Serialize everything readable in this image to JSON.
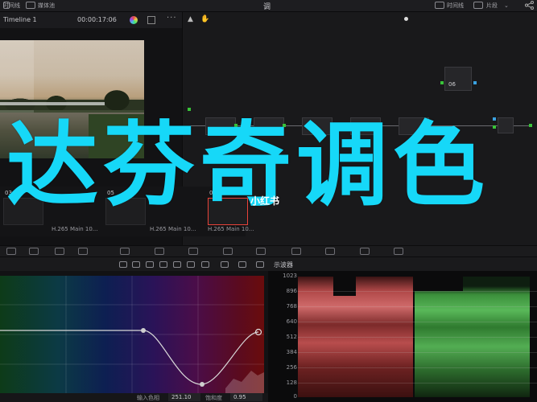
{
  "topbar": {
    "left_items": [
      "时间线",
      "媒体池"
    ],
    "center_title": "调",
    "right_items": [
      "时间线",
      "片段"
    ],
    "dropdown_arrow": "⌄"
  },
  "viewer": {
    "timeline_name": "Timeline 1",
    "timecode": "00:00:17:06",
    "more": "···"
  },
  "nodes": {
    "node_labels": [
      "06"
    ]
  },
  "overlay": {
    "title": "达芬奇调色",
    "watermark": "小红书"
  },
  "clips": {
    "numbers": [
      "03",
      "05",
      "07"
    ],
    "names": [
      "H.265 Main 10...",
      "H.265 Main 10...",
      "H.265 Main 10..."
    ]
  },
  "scopes": {
    "title": "示波器",
    "axis_ticks": [
      "1023",
      "896",
      "768",
      "640",
      "512",
      "384",
      "256",
      "128",
      "0"
    ]
  },
  "curves": {
    "input_label": "输入色相",
    "input_value": "251.10",
    "sat_label": "饱和度",
    "sat_value": "0.95"
  },
  "colors": {
    "accent_cyan": "#16d8f8",
    "selected_clip": "#e9433a",
    "port_green": "#39c339",
    "port_blue": "#3aa1e0"
  }
}
